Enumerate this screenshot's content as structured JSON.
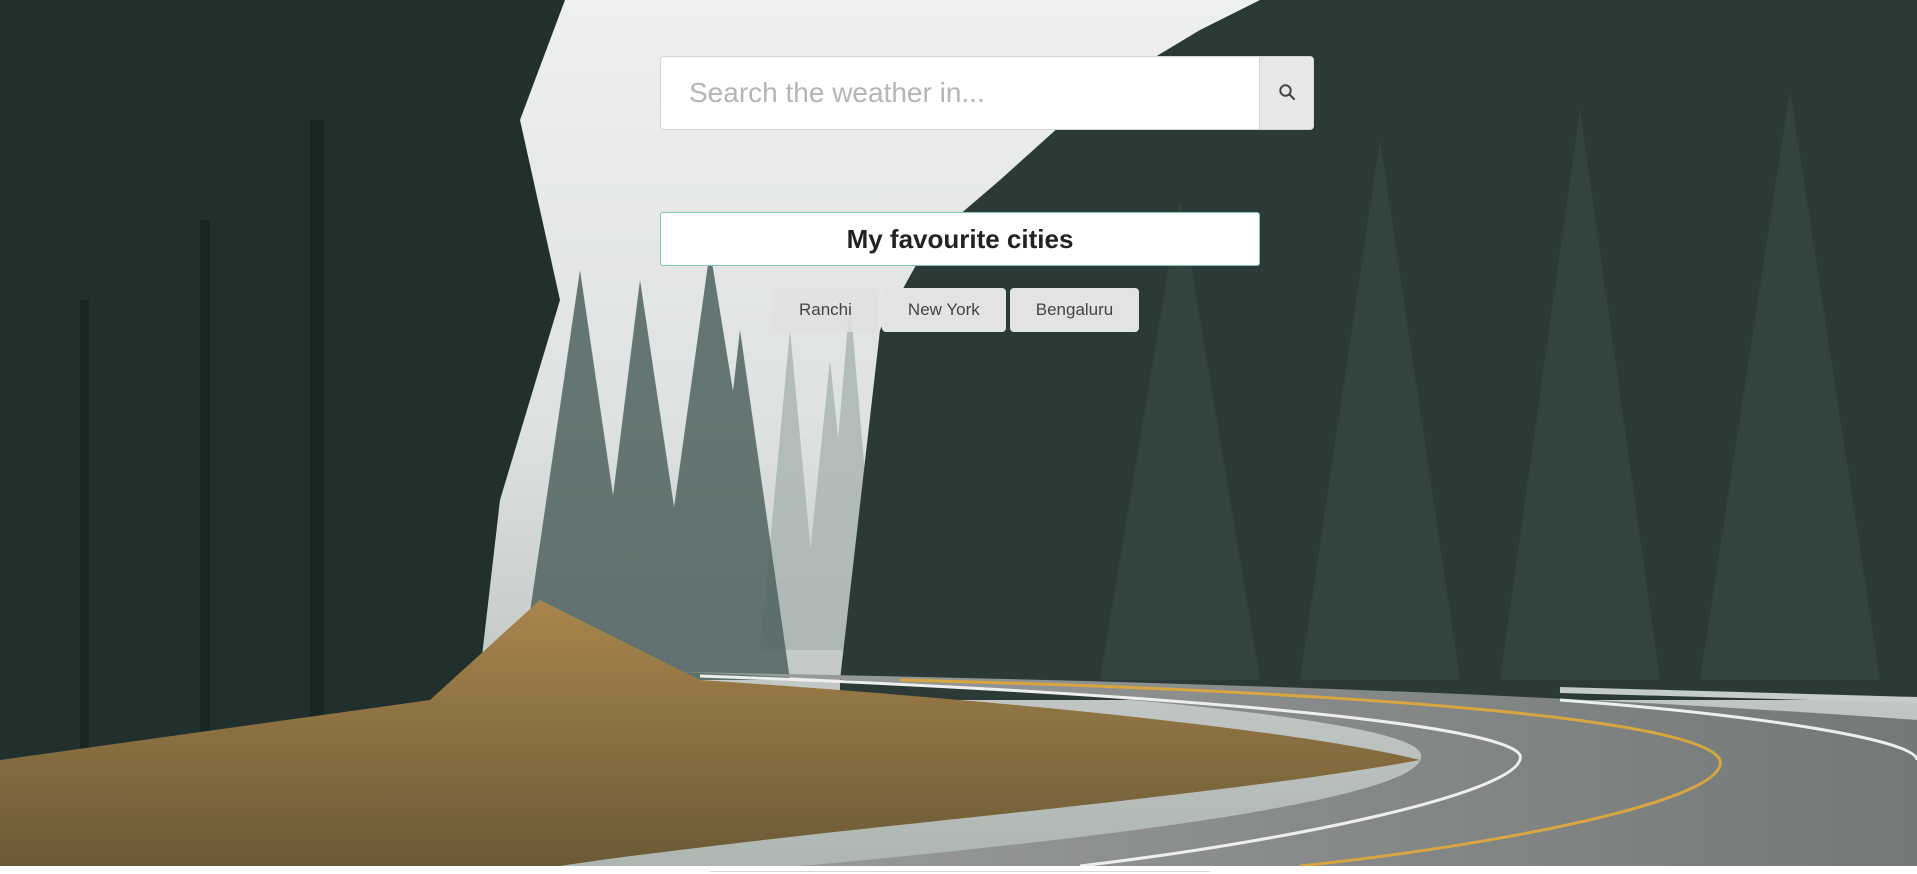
{
  "search": {
    "placeholder": "Search the weather in...",
    "value": "",
    "button_icon": "search-icon"
  },
  "favourites": {
    "title": "My favourite cities",
    "cities": [
      {
        "label": "Ranchi"
      },
      {
        "label": "New York"
      },
      {
        "label": "Bengaluru"
      }
    ]
  },
  "background": {
    "description_icon": "forest-road-photo"
  }
}
